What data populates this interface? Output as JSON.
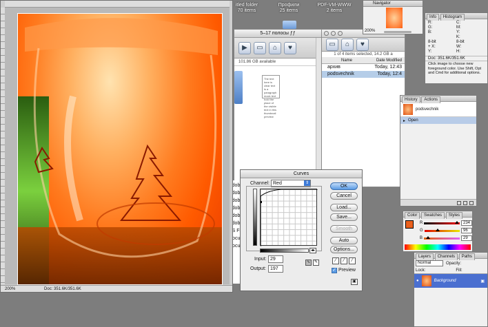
{
  "desktop": {
    "items": [
      {
        "label": "itled folder",
        "sub": "70 items"
      },
      {
        "label": "Профили",
        "sub": "25 items"
      },
      {
        "label": "PDF-VM-WWW",
        "sub": "2 items"
      }
    ]
  },
  "image_window": {
    "zoom": "200%",
    "doc_size": "Doc: 351.6K/351.6K"
  },
  "finder": {
    "title": "5–17 полосы ƒƒ",
    "capacity": "101.86 GB available",
    "doc_text": "The text here is clear text is a paragraph mock text hold the place of the visible text in this thumbnail preview"
  },
  "finder2": {
    "status": "1 of 4 items selected, 14.2 GB a",
    "columns": {
      "name": "Name",
      "modified": "Date Modified"
    },
    "rows": [
      {
        "name": "архив",
        "date": "Today, 12:43",
        "selected": false
      },
      {
        "name": "podsvechnik",
        "date": "Today, 12:4",
        "selected": true
      }
    ]
  },
  "navigator": {
    "tab": "Navigator",
    "zoom": "200%"
  },
  "info": {
    "tabs": [
      "Info",
      "Histogram"
    ],
    "rows": [
      [
        "R:",
        "C:"
      ],
      [
        "G:",
        "M:"
      ],
      [
        "B:",
        "Y:"
      ],
      [
        "",
        "K:"
      ],
      [
        "8-bit",
        "8-bit"
      ],
      [
        "+ X:",
        "W:"
      ],
      [
        "Y:",
        "H:"
      ]
    ],
    "doc": "Doc: 351.6K/351.6K",
    "hint": "Click image to choose new foreground color. Use Shift, Opt and Cmd for additional options."
  },
  "history": {
    "tabs": [
      "History",
      "Actions"
    ],
    "items": [
      {
        "label": "podsvechnik",
        "kind": "snapshot"
      },
      {
        "label": "Open",
        "kind": "step"
      }
    ]
  },
  "color": {
    "tabs": [
      "Color",
      "Swatches",
      "Styles"
    ],
    "channels": [
      {
        "name": "R",
        "value": "234",
        "fraction": 0.92
      },
      {
        "name": "G",
        "value": "96",
        "fraction": 0.38
      },
      {
        "name": "B",
        "value": "29",
        "fraction": 0.11
      }
    ],
    "foreground": "#ea601d"
  },
  "layers": {
    "tabs": [
      "Layers",
      "Channels",
      "Paths"
    ],
    "mode": "Normal",
    "opacity_label": "Opacity:",
    "lock_label": "Lock:",
    "fill_label": "Fill:",
    "layer": "Background"
  },
  "curves": {
    "title": "Curves",
    "channel_label": "Channel:",
    "channel": "Red",
    "input_label": "Input:",
    "input": "29",
    "output_label": "Output:",
    "output": "197",
    "buttons": {
      "ok": "OK",
      "cancel": "Cancel",
      "load": "Load...",
      "save": "Save...",
      "smooth": "Smooth",
      "auto": "Auto",
      "options": "Options..."
    },
    "preview_label": "Preview",
    "preview_checked": true,
    "behind_list": [
      "Adob",
      "Adob",
      "Adob",
      "Adob",
      "Adob",
      "Adob",
      "PS Fi",
      "Docu",
      "Docu"
    ]
  }
}
